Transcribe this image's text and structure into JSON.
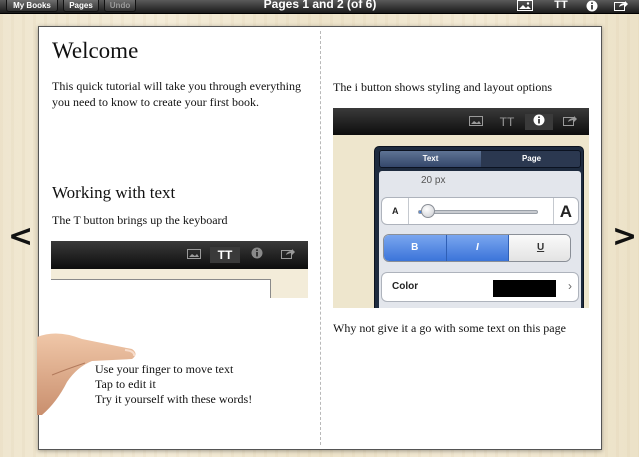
{
  "toolbar": {
    "my_books_label": "My Books",
    "pages_label": "Pages",
    "undo_label": "Undo",
    "title": "Pages 1 and 2 (of 6)",
    "icons": [
      "image-icon",
      "text-style-icon",
      "info-icon",
      "share-icon"
    ],
    "text_glyph": "TT",
    "info_glyph": "i"
  },
  "left_page": {
    "heading": "Welcome",
    "intro": "This quick tutorial will take you through everything you need to know to create your first book.",
    "subheading": "Working with text",
    "t_button_text": "The T button brings up the keyboard",
    "finger_instructions": [
      "Use your finger to move text",
      "Tap to edit it",
      "Try it yourself with these words!"
    ]
  },
  "right_page": {
    "i_button_text": "The i button shows styling and layout options",
    "popover": {
      "tabs": [
        "Text",
        "Page"
      ],
      "active_tab": "Text",
      "font_size_label": "20 px",
      "font_size_small": "A",
      "font_size_large": "A",
      "slider_fraction": 0.08,
      "style_buttons": [
        "B",
        "I",
        "U"
      ],
      "style_active": [
        "B",
        "I"
      ],
      "color_label": "Color",
      "color_value": "#000000"
    },
    "try_text": "Why not give it a go with some text on this page"
  },
  "nav": {
    "prev_glyph": "<",
    "next_glyph": ">"
  },
  "colors": {
    "accent_blue": "#3b74d9",
    "toolbar_dark": "#1a1a1a",
    "popover_navy": "#1e2b3f"
  }
}
